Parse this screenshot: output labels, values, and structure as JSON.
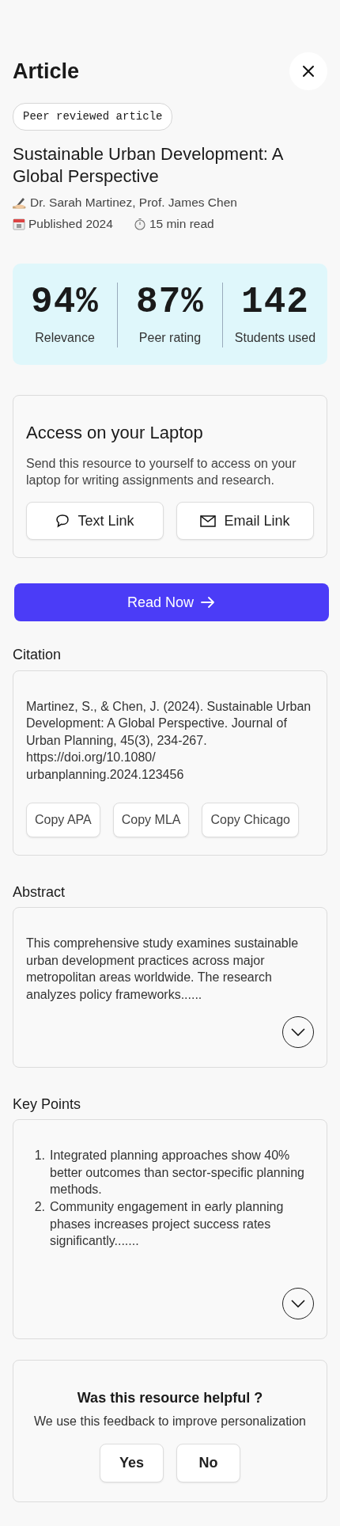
{
  "header": {
    "title": "Article"
  },
  "badge": "Peer reviewed article",
  "article": {
    "title": "Sustainable Urban Development: A Global Perspective",
    "authors": "Dr. Sarah Martinez, Prof. James Chen",
    "published": "Published 2024",
    "read_time": "15 min read"
  },
  "stats": [
    {
      "value": "94%",
      "label": "Relevance"
    },
    {
      "value": "87%",
      "label": "Peer rating"
    },
    {
      "value": "142",
      "label": "Students used"
    }
  ],
  "access_card": {
    "title": "Access on your Laptop",
    "description": "Send this resource to yourself to access on your laptop for writing assignments and research.",
    "buttons": [
      {
        "kind": "text",
        "label": "Text Link"
      },
      {
        "kind": "email",
        "label": "Email Link"
      }
    ]
  },
  "read_button": "Read Now",
  "citation": {
    "heading": "Citation",
    "text": "Martinez, S., & Chen, J. (2024). Sustainable Urban Development: A Global Perspective. Journal of Urban Planning, 45(3), 234-267. https://doi.org/10.1080/ urbanplanning.2024.123456",
    "buttons": [
      "Copy APA",
      "Copy MLA",
      "Copy Chicago"
    ]
  },
  "abstract": {
    "heading": "Abstract",
    "text": "This comprehensive study examines sustainable urban development practices across major metropolitan areas worldwide. The research analyzes policy frameworks......"
  },
  "key_points": {
    "heading": "Key Points",
    "items": [
      {
        "number": "1.",
        "text": "Integrated planning approaches show 40% better outcomes than sector-specific planning methods."
      },
      {
        "number": "2.",
        "text": "Community engagement in early planning phases increases project success rates significantly......."
      }
    ]
  },
  "feedback": {
    "question": "Was this resource helpful ?",
    "note": "We use this feedback to improve personalization",
    "buttons": [
      "Yes",
      "No"
    ]
  }
}
